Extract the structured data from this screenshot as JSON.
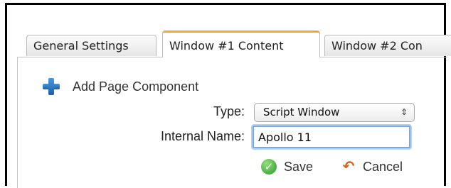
{
  "tabs": [
    {
      "label": "General Settings"
    },
    {
      "label": "Window #1 Content"
    },
    {
      "label": "Window #2 Con"
    }
  ],
  "add_component": {
    "label": "Add Page Component",
    "icon": "plus-icon"
  },
  "form": {
    "type_label": "Type:",
    "type_value": "Script Window",
    "name_label": "Internal Name:",
    "name_value": "Apollo 11"
  },
  "actions": {
    "save_label": "Save",
    "cancel_label": "Cancel"
  },
  "colors": {
    "active_tab_accent": "#f3a43a",
    "focus_ring": "#7aa9e0",
    "plus_icon": "#2f78c6",
    "save_icon": "#3aa832",
    "cancel_icon": "#d8611c"
  }
}
